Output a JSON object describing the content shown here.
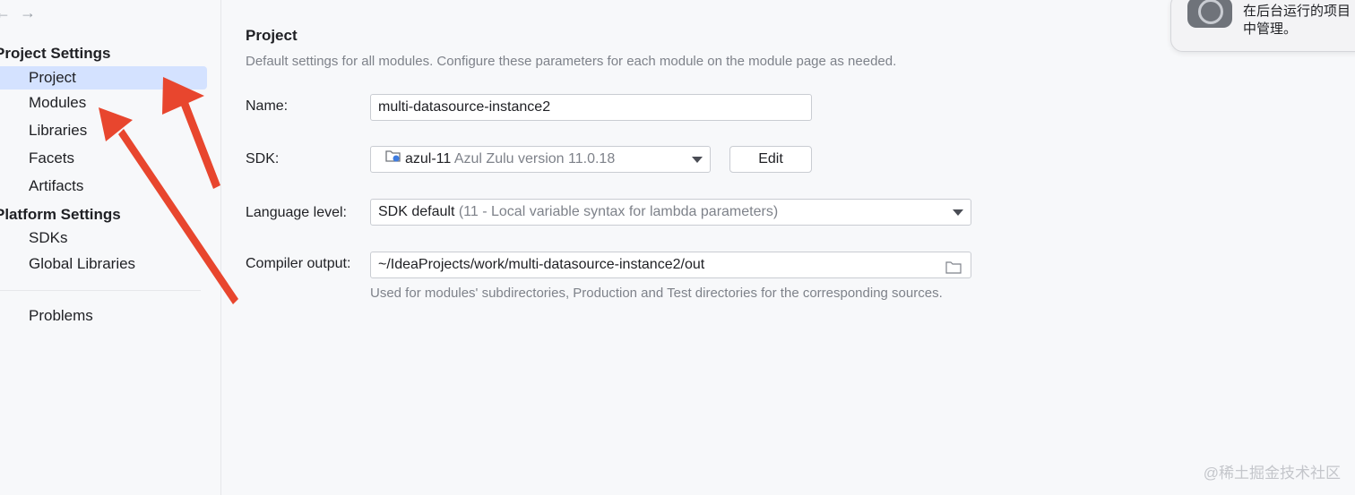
{
  "nav": {
    "back": "←",
    "forward": "→"
  },
  "sidebar": {
    "project_settings_title": "Project Settings",
    "project_items": [
      {
        "label": "Project",
        "selected": true
      },
      {
        "label": "Modules"
      },
      {
        "label": "Libraries"
      },
      {
        "label": "Facets"
      },
      {
        "label": "Artifacts"
      }
    ],
    "platform_settings_title": "Platform Settings",
    "platform_items": [
      {
        "label": "SDKs"
      },
      {
        "label": "Global Libraries"
      }
    ],
    "problems_label": "Problems"
  },
  "main": {
    "title": "Project",
    "description": "Default settings for all modules. Configure these parameters for each module on the module page as needed.",
    "name_label": "Name:",
    "name_value": "multi-datasource-instance2",
    "sdk_label": "SDK:",
    "sdk_name": "azul-11",
    "sdk_version": "Azul Zulu version 11.0.18",
    "edit_label": "Edit",
    "language_label": "Language level:",
    "language_value": "SDK default",
    "language_detail": "(11 - Local variable syntax for lambda parameters)",
    "compiler_label": "Compiler output:",
    "compiler_value": "~/IdeaProjects/work/multi-datasource-instance2/out",
    "compiler_hint": "Used for modules' subdirectories, Production and Test directories for the corresponding sources."
  },
  "notification": {
    "line1": "在后台运行的项目",
    "line2": "中管理。"
  },
  "watermark": "@稀土掘金技术社区",
  "colors": {
    "accent_selection": "#d4e2ff",
    "annotation_arrow": "#e8462e"
  }
}
